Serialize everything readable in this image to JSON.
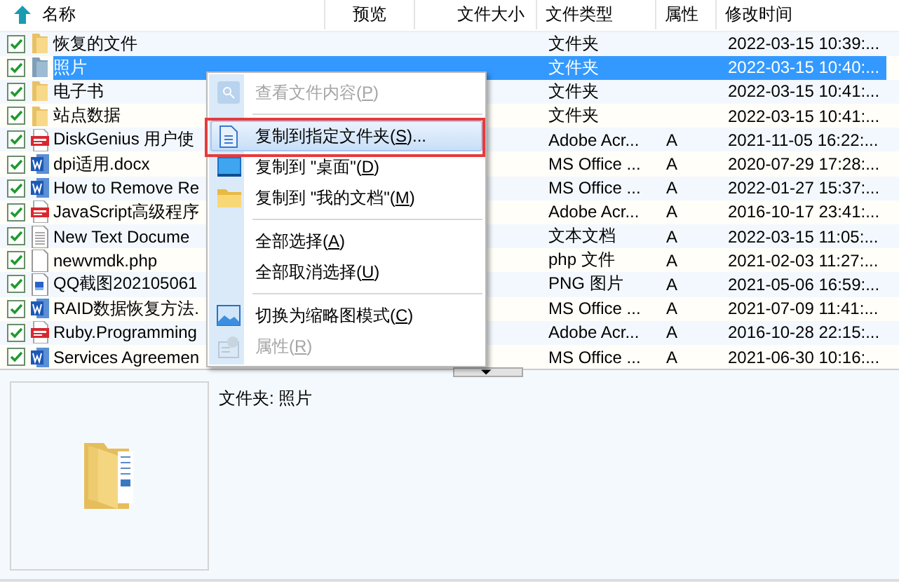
{
  "header": {
    "columns": [
      "名称",
      "预览",
      "文件大小",
      "文件类型",
      "属性",
      "修改时间"
    ]
  },
  "rows": [
    {
      "name": "恢复的文件",
      "kind": "folder",
      "checked": true,
      "selected": false,
      "type": "文件夹",
      "modified": "2022-03-15 10:39:..."
    },
    {
      "name": "照片",
      "kind": "folder",
      "checked": true,
      "selected": true,
      "type": "文件夹",
      "modified": "2022-03-15 10:40:..."
    },
    {
      "name": "电子书",
      "kind": "folder",
      "checked": true,
      "selected": false,
      "type": "文件夹",
      "modified": "2022-03-15 10:41:..."
    },
    {
      "name": "站点数据",
      "kind": "folder",
      "checked": true,
      "selected": false,
      "type": "文件夹",
      "modified": "2022-03-15 10:41:..."
    },
    {
      "name": "DiskGenius 用户使",
      "kind": "pdf",
      "checked": true,
      "selected": false,
      "type": "Adobe Acr...",
      "attr": "A",
      "modified": "2021-11-05 16:22:..."
    },
    {
      "name": "dpi适用.docx",
      "kind": "word",
      "checked": true,
      "selected": false,
      "type": "MS Office ...",
      "attr": "A",
      "modified": "2020-07-29 17:28:..."
    },
    {
      "name": "How to Remove Re",
      "kind": "word",
      "checked": true,
      "selected": false,
      "type": "MS Office ...",
      "attr": "A",
      "modified": "2022-01-27 15:37:..."
    },
    {
      "name": "JavaScript高级程序",
      "kind": "pdf",
      "checked": true,
      "selected": false,
      "type": "Adobe Acr...",
      "attr": "A",
      "modified": "2016-10-17 23:41:..."
    },
    {
      "name": "New Text Docume",
      "kind": "text",
      "checked": true,
      "selected": false,
      "type": "文本文档",
      "attr": "A",
      "modified": "2022-03-15 11:05:..."
    },
    {
      "name": "newvmdk.php",
      "kind": "blank",
      "checked": true,
      "selected": false,
      "type": "php 文件",
      "attr": "A",
      "modified": "2021-02-03 11:27:..."
    },
    {
      "name": "QQ截图202105061",
      "kind": "image",
      "checked": true,
      "selected": false,
      "type": "PNG 图片",
      "attr": "A",
      "modified": "2021-05-06 16:59:..."
    },
    {
      "name": "RAID数据恢复方法.",
      "kind": "word",
      "checked": true,
      "selected": false,
      "type": "MS Office ...",
      "attr": "A",
      "modified": "2021-07-09 11:41:..."
    },
    {
      "name": "Ruby.Programming",
      "kind": "pdf",
      "checked": true,
      "selected": false,
      "type": "Adobe Acr...",
      "attr": "A",
      "modified": "2016-10-28 22:15:..."
    },
    {
      "name": "Services Agreemen",
      "kind": "word",
      "checked": true,
      "selected": false,
      "type": "MS Office ...",
      "attr": "A",
      "modified": "2021-06-30 10:16:..."
    }
  ],
  "context_menu": {
    "items": [
      {
        "kind": "view",
        "label": "查看文件内容(",
        "key": "P",
        "tail": ")",
        "disabled": true,
        "selected": false
      },
      {
        "kind": "separator"
      },
      {
        "kind": "copy-folder",
        "label": "复制到指定文件夹(",
        "key": "S",
        "tail": ")...",
        "disabled": false,
        "selected": true
      },
      {
        "kind": "desktop",
        "label": "复制到 \"桌面\"(",
        "key": "D",
        "tail": ")",
        "disabled": false,
        "selected": false
      },
      {
        "kind": "documents",
        "label": "复制到 \"我的文档\"(",
        "key": "M",
        "tail": ")",
        "disabled": false,
        "selected": false
      },
      {
        "kind": "separator"
      },
      {
        "kind": "plain",
        "label": "全部选择(",
        "key": "A",
        "tail": ")",
        "disabled": false,
        "selected": false
      },
      {
        "kind": "plain",
        "label": "全部取消选择(",
        "key": "U",
        "tail": ")",
        "disabled": false,
        "selected": false
      },
      {
        "kind": "separator"
      },
      {
        "kind": "thumbnail",
        "label": "切换为缩略图模式(",
        "key": "C",
        "tail": ")",
        "disabled": false,
        "selected": false
      },
      {
        "kind": "properties",
        "label": "属性(",
        "key": "R",
        "tail": ")",
        "disabled": true,
        "selected": false
      }
    ]
  },
  "detail": {
    "caption": "文件夹: 照片"
  }
}
